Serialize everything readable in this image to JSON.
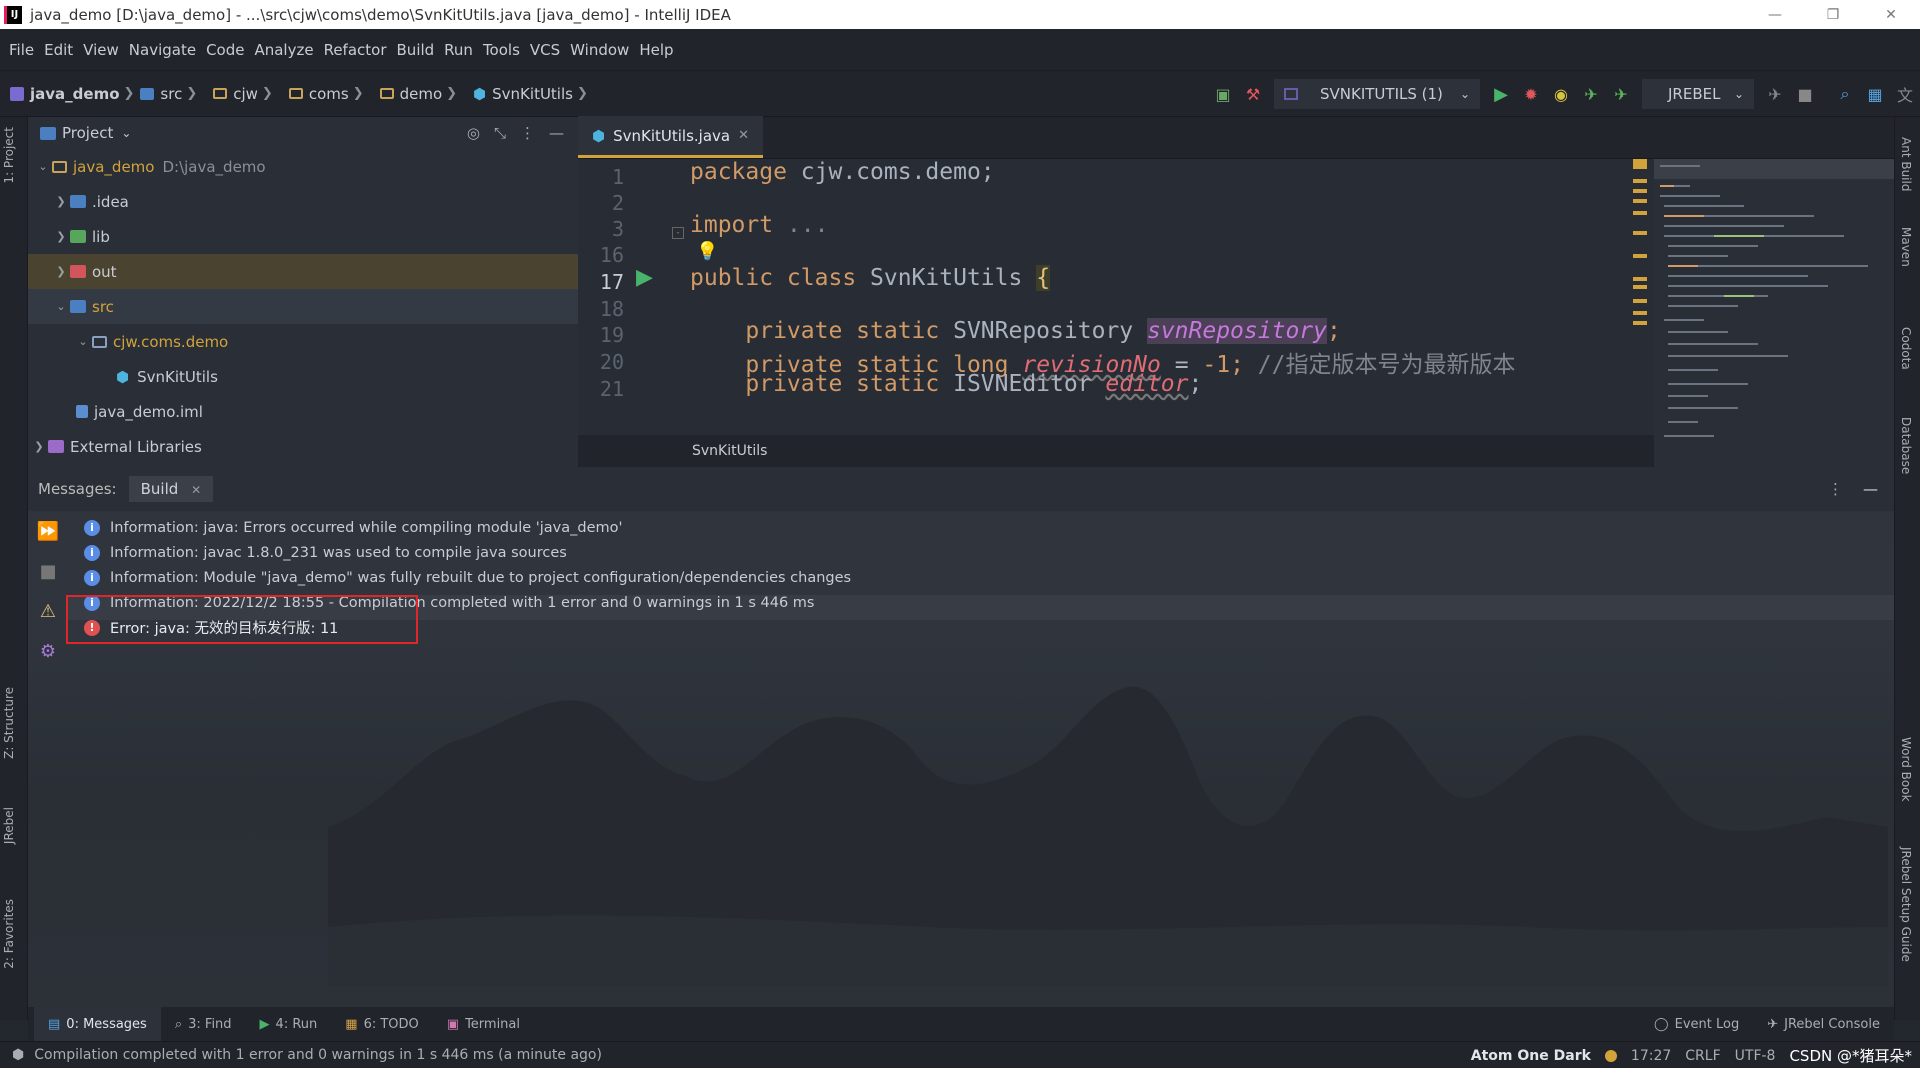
{
  "window": {
    "title": "java_demo [D:\\java_demo] - ...\\src\\cjw\\coms\\demo\\SvnKitUtils.java [java_demo] - IntelliJ IDEA",
    "logo_text": "IJ",
    "minimize": "—",
    "restore": "❐",
    "close": "✕"
  },
  "menu": [
    "File",
    "Edit",
    "View",
    "Navigate",
    "Code",
    "Analyze",
    "Refactor",
    "Build",
    "Run",
    "Tools",
    "VCS",
    "Window",
    "Help"
  ],
  "breadcrumb": [
    "java_demo",
    "src",
    "cjw",
    "coms",
    "demo",
    "SvnKitUtils"
  ],
  "toolbar": {
    "run_config": "SVNKITUTILS (1)",
    "jrebel": "JREBEL"
  },
  "project": {
    "header": "Project",
    "tree": [
      {
        "label": "java_demo",
        "path": "D:\\java_demo"
      },
      {
        "label": ".idea"
      },
      {
        "label": "lib"
      },
      {
        "label": "out"
      },
      {
        "label": "src"
      },
      {
        "label": "cjw.coms.demo"
      },
      {
        "label": "SvnKitUtils"
      },
      {
        "label": "java_demo.iml"
      },
      {
        "label": "External Libraries"
      }
    ]
  },
  "editor": {
    "tab": "SvnKitUtils.java",
    "line_numbers": [
      "1",
      "2",
      "3",
      "16",
      "17",
      "18",
      "19",
      "20",
      "21"
    ],
    "lines": {
      "l1_kw": "package",
      "l1_rest": " cjw.coms.demo;",
      "l3_kw": "import",
      "l3_rest": " ...",
      "l17_kw": "public class",
      "l17_rest": " SvnKitUtils ",
      "l17_brace": "{",
      "l19_kw": "    private static",
      "l19_type": " SVNRepository ",
      "l19_field": "svnRepository",
      "l19_end": ";",
      "l20_kw": "    private static long",
      "l20_sp": " ",
      "l20_field": "revisionNo",
      "l20_eq": " = ",
      "l20_num": "-1",
      "l20_semi": "; ",
      "l20_comment": "//指定版本号为最新版本",
      "l21_kw": "    private static",
      "l21_type": " ISVNEditor ",
      "l21_field": "editor",
      "l21_end": ";"
    },
    "footer_breadcrumb": "SvnKitUtils"
  },
  "messages": {
    "label": "Messages:",
    "tab": "Build",
    "rows": [
      "Information: java: Errors occurred while compiling module 'java_demo'",
      "Information: javac 1.8.0_231 was used to compile java sources",
      "Information: Module \"java_demo\" was fully rebuilt due to project configuration/dependencies changes",
      "Information: 2022/12/2 18:55 - Compilation completed with 1 error and 0 warnings in 1 s 446 ms"
    ],
    "error": "Error: java: 无效的目标发行版: 11"
  },
  "side_tabs_left": [
    "1: Project",
    "Z: Structure",
    "JRebel",
    "2: Favorites"
  ],
  "side_tabs_right": [
    "Ant Build",
    "Maven",
    "Codota",
    "Database",
    "Word Book",
    "JRebel Setup Guide"
  ],
  "bottom_tabs": [
    {
      "label": "0: Messages"
    },
    {
      "label": "3: Find"
    },
    {
      "label": "4: Run"
    },
    {
      "label": "6: TODO"
    },
    {
      "label": "Terminal"
    }
  ],
  "bottom_right_tabs": [
    "Event Log",
    "JRebel Console"
  ],
  "status": {
    "text": "Compilation completed with 1 error and 0 warnings in 1 s 446 ms (a minute ago)",
    "theme": "Atom One Dark",
    "position": "17:27",
    "line_sep": "CRLF",
    "encoding": "UTF-8",
    "watermark": "CSDN @*猪耳朵*"
  },
  "colors": {
    "accent": "#d1a33a",
    "error": "#e05252",
    "info": "#5a8ee6",
    "highlight_box": "#e0262a"
  }
}
